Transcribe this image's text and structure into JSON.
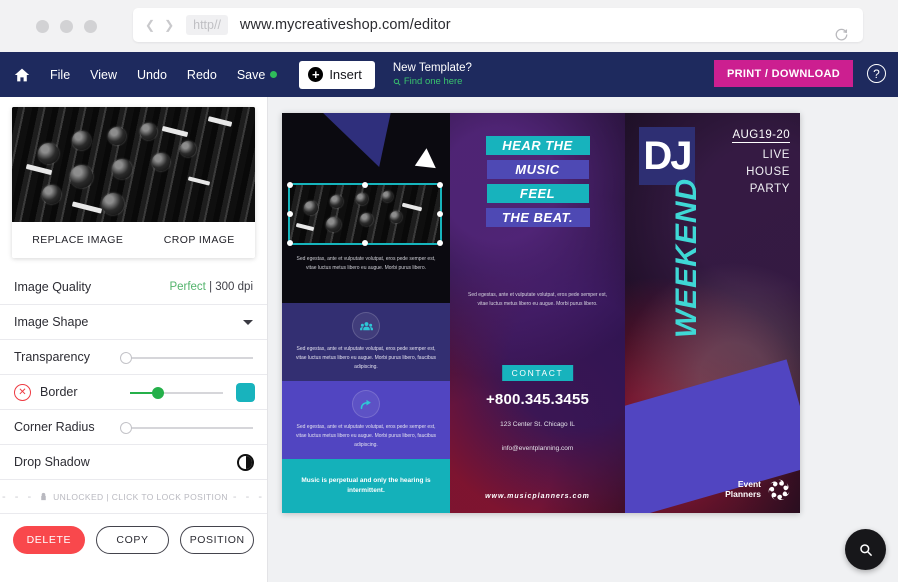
{
  "browser": {
    "http_chip": "http//",
    "url": "www.mycreativeshop.com/editor",
    "back_icon": "chevron-left-icon",
    "forward_icon": "chevron-right-icon",
    "reload_icon": "reload-icon"
  },
  "toolbar": {
    "home_icon": "home-icon",
    "items": [
      {
        "label": "File"
      },
      {
        "label": "View"
      },
      {
        "label": "Undo"
      },
      {
        "label": "Redo"
      },
      {
        "label": "Save"
      }
    ],
    "save_status_color": "#2fbd5a",
    "insert_label": "Insert",
    "new_template_title": "New Template?",
    "new_template_link": "Find one here",
    "print_label": "PRINT / DOWNLOAD",
    "print_color": "#cc1f90",
    "help_icon": "question-mark-icon",
    "background_color": "#1e2a5e"
  },
  "panel": {
    "thumbnail_actions": {
      "replace": "REPLACE IMAGE",
      "crop": "CROP IMAGE"
    },
    "rows": {
      "image_quality": {
        "label": "Image Quality",
        "quality": "Perfect",
        "separator": " | ",
        "dpi": "300 dpi",
        "quality_color": "#52b36b"
      },
      "image_shape": {
        "label": "Image Shape"
      },
      "transparency": {
        "label": "Transparency",
        "value": 0
      },
      "border": {
        "label": "Border",
        "value": 28,
        "swatch_color": "#18b3bd"
      },
      "corner_radius": {
        "label": "Corner Radius",
        "value": 0
      },
      "drop_shadow": {
        "label": "Drop Shadow"
      }
    },
    "lock_row": {
      "text": "UNLOCKED | CLICK TO LOCK POSITION",
      "icon": "lock-icon"
    },
    "buttons": {
      "delete": "DELETE",
      "copy": "COPY",
      "position": "POSITION"
    }
  },
  "brochure": {
    "left_panel": {
      "body_1": "Sed egestas, ante et vulputate volutpat, eros pede semper est, vitae luctus metus libero eu augue. Morbi purus libero.",
      "section_1": {
        "icon": "people-group-icon",
        "body": "Sed egestas, ante et vulputate volutpat, eros pede semper est, vitae luctus metus libero eu augue. Morbi purus libero, faucibus adipiscing."
      },
      "section_2": {
        "icon": "share-arrow-icon",
        "body": "Sed egestas, ante et vulputate volutpat, eros pede semper est, vitae luctus metus libero eu augue. Morbi purus libero, faucibus adipiscing."
      },
      "footer_quote": "Music is perpetual and only the hearing is intermittent."
    },
    "middle_panel": {
      "headline": [
        "HEAR THE",
        "MUSIC",
        "FEEL",
        "THE BEAT."
      ],
      "body": "Sed egestas, ante et vulputate volutpat, eros pede semper est, vitae luctus metus libero eu augue. Morbi purus libero.",
      "contact_label": "CONTACT",
      "phone": "+800.345.3455",
      "address": "123 Center St. Chicago IL",
      "email": "info@eventplanning.com",
      "website": "www.musicplanners.com"
    },
    "right_panel": {
      "dj": "DJ",
      "date": "AUG19-20",
      "line_1": "LIVE",
      "line_2": "HOUSE",
      "line_3": "PARTY",
      "vertical_word": "WEEKEND",
      "logo_line_1": "Event",
      "logo_line_2": "Planners",
      "logo_icon": "pinwheel-logo-icon"
    }
  },
  "canvas": {
    "zoom_button_icon": "magnifier-icon"
  }
}
